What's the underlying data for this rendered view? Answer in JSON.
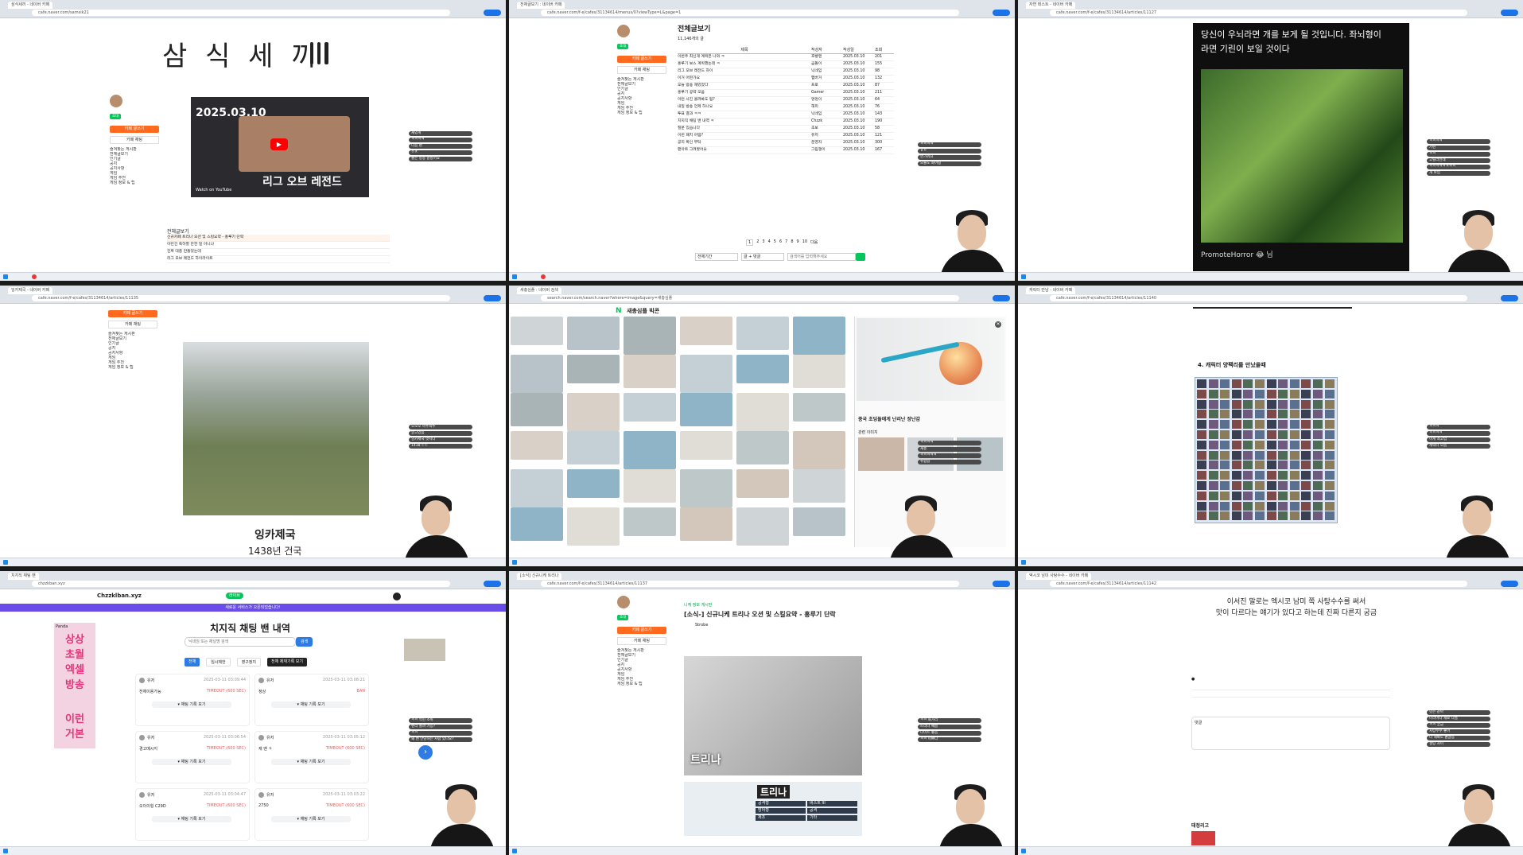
{
  "layout": "3x3 screen-capture grid",
  "panels": [
    {
      "id": "p1",
      "tab": "삼식세끼 - 네이버 카페",
      "url": "cafe.naver.com/samsik21",
      "cafe_title": "삼 식 세 끼",
      "video_date": "2025.03.10",
      "video_title": "리그 오브 레전드",
      "video_watch": "Watch on YouTube",
      "board_heading": "전체글보기",
      "write_button": "카페 글쓰기",
      "chat_button": "카페 채팅",
      "sidebar_rows": [
        "즐겨찾는 게시판",
        "전체글보기",
        "인기글",
        "공지",
        "공지사항",
        "게임",
        "게임 추천",
        "게임 정보 & 팁"
      ],
      "posts": [
        "신규카페 트리나 오션 및 스킬요약 - 홍루기 단락",
        "이런건 축하할 만한 일 아니냐",
        "진짜 대충 만들었는데",
        "리그 오브 레전드 하이라이트"
      ],
      "chat": [
        "재밌게",
        "ㅋㅋㅋㅋ",
        "다음 편",
        "ㅇㅈ",
        "좋은 방송 잘봤어요"
      ]
    },
    {
      "id": "p2",
      "tab": "전체글보기 : 네이버 카페",
      "url": "cafe.naver.com/f-e/cafes/31134614/menus/0?viewType=L&page=1",
      "board_title": "전체글보기",
      "total": "11,146개의 글",
      "columns": [
        "제목",
        "작성자",
        "작성일",
        "조회"
      ],
      "rows": [
        [
          "이번주 최신게 계획은 나와 ㅋ",
          "호빵맨",
          "2025.03.10",
          "201"
        ],
        [
          "홍루기 보스 계획했는데 ㅋ",
          "곰돌이",
          "2025.03.10",
          "155"
        ],
        [
          "리그 오브 레전드 하이",
          "닉네임",
          "2025.03.10",
          "98"
        ],
        [
          "이거 어떤가요",
          "햄버거",
          "2025.03.10",
          "132"
        ],
        [
          "오늘 방송 재밌었다",
          "프로",
          "2025.03.10",
          "87"
        ],
        [
          "홍루기 공략 모음",
          "Gamer",
          "2025.03.10",
          "211"
        ],
        [
          "이런 사진 올려봐도 됨?",
          "멍멍이",
          "2025.03.10",
          "64"
        ],
        [
          "내일 방송 언제 하나요",
          "해피",
          "2025.03.10",
          "76"
        ],
        [
          "투표 결과 ㅋㅋ",
          "닉네임",
          "2025.03.10",
          "143"
        ],
        [
          "치지직 채팅 밴 내역 ㅋ",
          "Chzzk",
          "2025.03.10",
          "190"
        ],
        [
          "질문 있습니다",
          "초보",
          "2025.03.10",
          "58"
        ],
        [
          "이번 패치 어떰?",
          "유저",
          "2025.03.10",
          "121"
        ],
        [
          "공지 확인 부탁",
          "운영자",
          "2025.03.10",
          "300"
        ],
        [
          "팬아트 그려봤어요",
          "그림쟁이",
          "2025.03.10",
          "167"
        ]
      ],
      "pager": [
        "1",
        "2",
        "3",
        "4",
        "5",
        "6",
        "7",
        "8",
        "9",
        "10",
        "다음"
      ],
      "search_placeholder": "검색어를 입력해주세요",
      "search_scope": "전체기간",
      "search_type": "글 + 댓글",
      "chat": [
        "ㅋㅋㅋㅋ",
        "ㅎㅇ",
        "반가워요",
        "오늘도 화이팅"
      ]
    },
    {
      "id": "p3",
      "tab": "자연 테스트 - 네이버 카페",
      "url": "cafe.naver.com/f-e/cafes/31134614/articles/11127",
      "caption": "당신이 우뇌라면 개를 보게 될 것입니다. 좌뇌형이라면 기린이 보일 것이다",
      "credit": "PromoteHorror 😂 님",
      "chat": [
        "ㅋㅋㅋㅋ",
        "기린",
        "ㅋㅋ",
        "고릴라인데",
        "ㅋㅋㅋㅋㅋㅋㅋㅋ",
        "개 보임"
      ]
    },
    {
      "id": "p4",
      "tab": "잉카제국 - 네이버 카페",
      "url": "cafe.naver.com/f-e/cafes/31134614/articles/11135",
      "title": "잉카제국",
      "subtitle": "1438년 건국",
      "chat": [
        "오오오 마추픽추",
        "알고있음",
        "잉카제국 멋지다",
        "1438 ㄷㄷ"
      ]
    },
    {
      "id": "p5",
      "tab": "새총심플 : 네이버 검색",
      "url": "search.naver.com/search.naver?where=image&query=새총심플",
      "query": "새총심플 빅콘",
      "preview_caption": "중국 초딩들에게 난리난 장난감",
      "related_label": "관련 이미지",
      "chat": [
        "ㅋㅋㅋㅋ",
        "새총",
        "ㅋㅋㅋㅋㅋ",
        "위험함"
      ]
    },
    {
      "id": "p6",
      "tab": "캐릭터 만남 - 네이버 카페",
      "url": "cafe.naver.com/f-e/cafes/31134614/articles/11140",
      "heading": "4. 캐릭터 양팩리를 만났을때",
      "chat": [
        "ㅋㅋㅋ",
        "ㅋㅋㅋㅋ",
        "이게 최고임",
        "캐릭터 모음"
      ]
    },
    {
      "id": "p7",
      "tab": "치지직 채팅 밴",
      "url": "chzzkban.xyz",
      "site": "Chzzklban.xyz",
      "live_badge": "라이브",
      "banner_text": "새로운 서비스가 오픈되었습니다!",
      "title": "치지직 채팅 밴 내역",
      "search_placeholder": "닉네임 또는 채널명 검색",
      "search_button": "검색",
      "filters": [
        "전체",
        "임시제한",
        "영구정지",
        "전체 제재기록 보기"
      ],
      "ad_text": [
        "상상",
        "초월",
        "엑셀",
        "방송",
        "이런",
        "거본"
      ],
      "ad_brand": "Panda",
      "cards": [
        {
          "user": "유저",
          "time": "2025-03-11 03:09:44",
          "msg": "전체이용가능",
          "badge": "TIMEOUT (600 SEC)",
          "action": "▾ 채팅 기록 보기"
        },
        {
          "user": "유저",
          "time": "2025-03-11 03:08:21",
          "msg": "정상",
          "badge": "BAN",
          "action": "▾ 채팅 기록 보기"
        },
        {
          "user": "유저",
          "time": "2025-03-11 03:06:54",
          "msg": "경고메시지",
          "badge": "TIMEOUT (600 SEC)",
          "action": "▾ 채팅 기록 보기"
        },
        {
          "user": "유저",
          "time": "2025-03-11 03:05:12",
          "msg": "재 밴 ㅋ",
          "badge": "TIMEOUT (600 SEC)",
          "action": "▾ 채팅 기록 보기"
        },
        {
          "user": "유저",
          "time": "2025-03-11 03:04:47",
          "msg": "오이이힝 C29D",
          "badge": "TIMEOUT (600 SEC)",
          "action": "▾ 채팅 기록 보기"
        },
        {
          "user": "유저",
          "time": "2025-03-11 03:03:22",
          "msg": "2750",
          "badge": "TIMEOUT (600 SEC)",
          "action": "▾ 채팅 기록 보기"
        }
      ],
      "chat": [
        "ㅋㅋ 막힌 소위",
        "밴리 될까 가능?",
        "ㅋㅋ",
        "왜 밴 안당하는 사람 있나요?"
      ]
    },
    {
      "id": "p8",
      "tab": "[소식] 신규니케 트리나",
      "url": "cafe.naver.com/f-e/cafes/31134614/articles/11137",
      "category": "니케 정보 게시판",
      "title": "[소식-] 신규니케 트리나 오션 및 스킬요약 - 홍루기 단락",
      "author": "Strobe",
      "image_label_1": "트리나",
      "image_label_2": "트리나",
      "stats": [
        "공격형",
        "버스트 III",
        "방어형",
        "공격",
        "제조",
        "기타"
      ],
      "chat": [
        "ㅋㅋ 화가리",
        "트리나 예쁨",
        "나이트 좋음",
        "ㅋㅋ 이쁘다"
      ]
    },
    {
      "id": "p9",
      "tab": "엑시코 남미 사탕수수 - 네이버 카페",
      "url": "cafe.naver.com/f-e/cafes/31134614/articles/11142",
      "text_line1": "이서진 말로는 엑시코 남미 쪽 사탕수수를 써서",
      "text_line2": "맛이 다르다는 얘기가 있다고 하는데 진짜 다른지 궁금",
      "comment_box_label": "댓글",
      "related_heading": "태정리고",
      "chat": [
        "맛은 같아",
        "나라마다 재료 다름",
        "ㅋㅋ 궁금",
        "사탕수수 좋아",
        "다 해봐도 괜찮음",
        "설탕 차이"
      ]
    }
  ],
  "colors": {
    "naver_green": "#03c75a",
    "cafe_orange": "#ff6a1f",
    "chrome_bar": "#dfe3ea",
    "chat_bg": "#4a4a4a",
    "chzzk_purple": "#6a4ce8"
  }
}
